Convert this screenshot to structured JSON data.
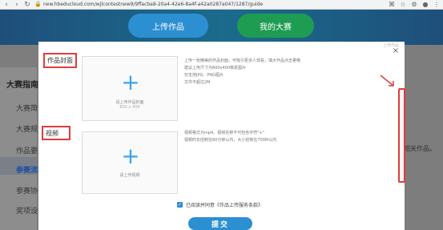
{
  "browser": {
    "url": "new.hbeducloud.com/wjlcontestnew9/9ffacba8-20a4-42e6-8a4f-a42a0287a047/1287/guide"
  },
  "header": {
    "upload_label": "上传作品",
    "mine_label": "我的大赛"
  },
  "sidebar": {
    "title": "大赛指南",
    "items": [
      "大赛简介",
      "大赛规则",
      "作品要求",
      "参赛流程",
      "参赛协议",
      "奖项设置"
    ]
  },
  "right_text": "相关作品。",
  "modal": {
    "title": "上传作品",
    "cover": {
      "label": "作品封面",
      "box_text": "请上传作品封面",
      "box_size": "600 x 400",
      "desc": [
        "上传一张精美的作品封面，可吸引更多人观看，填大作品点击量哦",
        "建议上传尺寸为600x400像素图片",
        "仅支持JPG、PNG图片",
        "文件不超过2M"
      ]
    },
    "video": {
      "label": "视频",
      "box_text": "请上传视频",
      "desc": [
        "视频格式为mp4、视频名称不可包含字符\"+\"",
        "视频时长控制在60分钟以内，大小控制在700M以内"
      ]
    },
    "agree_text": "已阅读并同意《作品上传服务条款》",
    "submit_label": "提交"
  },
  "colors": {
    "primary": "#2c8fd1",
    "green": "#1e9d52",
    "highlight_red": "#e23b3b"
  }
}
